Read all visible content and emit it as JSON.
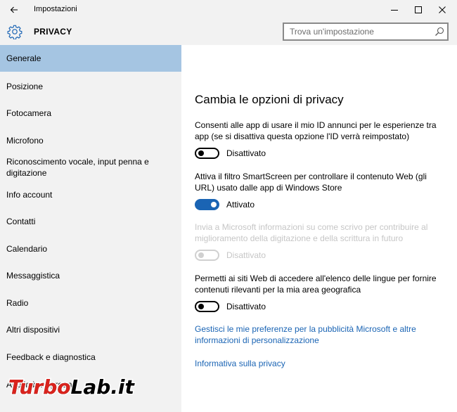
{
  "window": {
    "title": "Impostazioni"
  },
  "header": {
    "section_title": "PRIVACY",
    "search_placeholder": "Trova un'impostazione"
  },
  "sidebar": {
    "items": [
      {
        "label": "Generale",
        "selected": true
      },
      {
        "label": "Posizione"
      },
      {
        "label": "Fotocamera"
      },
      {
        "label": "Microfono"
      },
      {
        "label": "Riconoscimento vocale, input penna e digitazione"
      },
      {
        "label": "Info account"
      },
      {
        "label": "Contatti"
      },
      {
        "label": "Calendario"
      },
      {
        "label": "Messaggistica"
      },
      {
        "label": "Radio"
      },
      {
        "label": "Altri dispositivi"
      },
      {
        "label": "Feedback e diagnostica"
      },
      {
        "label": "App in background"
      }
    ]
  },
  "main": {
    "heading": "Cambia le opzioni di privacy",
    "options": [
      {
        "description": "Consenti alle app di usare il mio ID annunci per le esperienze tra app (se si disattiva questa opzione l'ID verrà reimpostato)",
        "state": "Disattivato",
        "on": false,
        "enabled": true
      },
      {
        "description": "Attiva il filtro SmartScreen per controllare il contenuto Web (gli URL) usato dalle app di Windows Store",
        "state": "Attivato",
        "on": true,
        "enabled": true
      },
      {
        "description": "Invia a Microsoft informazioni su come scrivo per contribuire al miglioramento della digitazione e della scrittura in futuro",
        "state": "Disattivato",
        "on": false,
        "enabled": false
      },
      {
        "description": "Permetti ai siti Web di accedere all'elenco delle lingue per fornire contenuti rilevanti per la mia area geografica",
        "state": "Disattivato",
        "on": false,
        "enabled": true
      }
    ],
    "links": [
      {
        "label": "Gestisci le mie preferenze per la pubblicità Microsoft e altre informazioni di personalizzazione"
      },
      {
        "label": "Informativa sulla privacy"
      }
    ]
  },
  "watermark": {
    "text": "TurboLab.it"
  },
  "colors": {
    "accent": "#1a64b4",
    "selected_nav": "#a5c5e2",
    "chrome_bg": "#f2f2f2",
    "watermark_red": "#d9231d"
  }
}
